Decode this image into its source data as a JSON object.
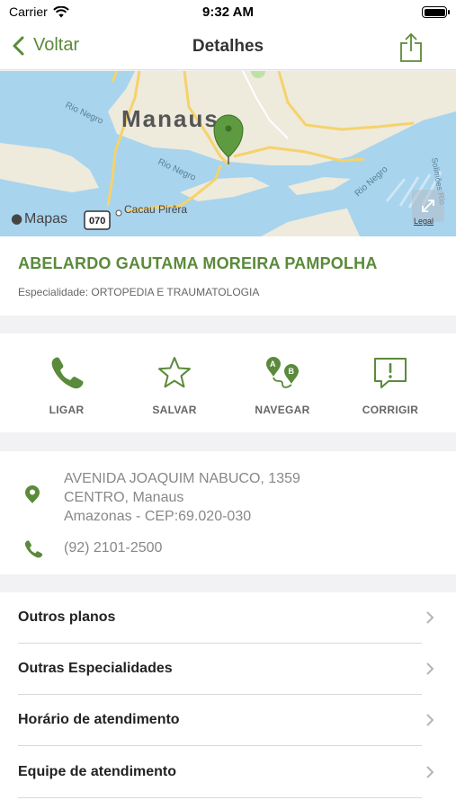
{
  "status_bar": {
    "carrier": "Carrier",
    "time": "9:32 AM"
  },
  "nav": {
    "back_label": "Voltar",
    "title": "Detalhes"
  },
  "map": {
    "city_label": "Manaus",
    "river_labels": [
      "Rio Negro",
      "Rio Negro",
      "Rio Negro",
      "Solimões Rio"
    ],
    "place_label": "Cacau Pirêra",
    "road_shield": "070",
    "maps_brand": "Mapas",
    "legal": "Legal"
  },
  "provider": {
    "name": "ABELARDO GAUTAMA MOREIRA PAMPOLHA",
    "specialty": "Especialidade: ORTOPEDIA E TRAUMATOLOGIA"
  },
  "actions": [
    {
      "label": "LIGAR",
      "icon": "phone-icon"
    },
    {
      "label": "SALVAR",
      "icon": "star-icon"
    },
    {
      "label": "NAVEGAR",
      "icon": "route-icon"
    },
    {
      "label": "CORRIGIR",
      "icon": "report-icon"
    }
  ],
  "contact": {
    "address_line1": "AVENIDA JOAQUIM NABUCO, 1359",
    "address_line2": "CENTRO, Manaus",
    "address_line3": "Amazonas - CEP:69.020-030",
    "phone": "(92) 2101-2500"
  },
  "menu": [
    {
      "label": "Outros planos"
    },
    {
      "label": "Outras Especialidades"
    },
    {
      "label": "Horário de atendimento"
    },
    {
      "label": "Equipe de atendimento"
    }
  ],
  "colors": {
    "accent": "#5a8a3a",
    "water": "#a8d4ee",
    "land": "#eeeadc",
    "road": "#f5d36b"
  }
}
